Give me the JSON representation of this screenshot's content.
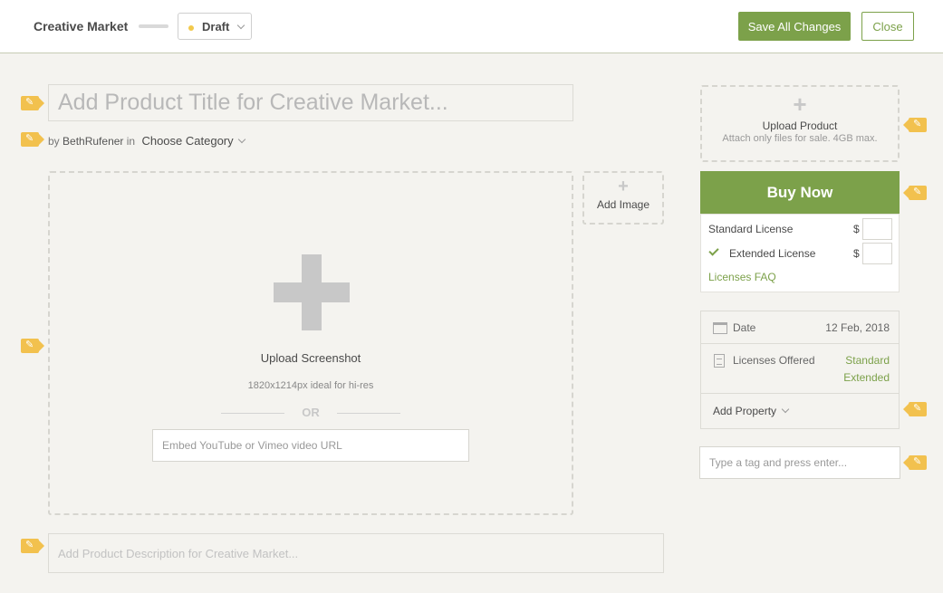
{
  "header": {
    "brand": "Creative Market",
    "status_label": "Draft",
    "save_label": "Save All Changes",
    "close_label": "Close"
  },
  "product": {
    "title_placeholder": "Add Product Title for Creative Market...",
    "by_prefix": "by",
    "author": "BethRufener",
    "in_word": "in",
    "category_label": "Choose Category",
    "description_placeholder": "Add Product Description for Creative Market..."
  },
  "media": {
    "upload_title": "Upload Screenshot",
    "upload_hint": "1820x1214px ideal for hi-res",
    "or_text": "OR",
    "embed_placeholder": "Embed YouTube or Vimeo video URL",
    "add_image_plus": "+",
    "add_image_label": "Add Image"
  },
  "sidebar": {
    "upload_plus": "+",
    "upload_label": "Upload Product",
    "upload_hint": "Attach only files for sale. 4GB max.",
    "buy_now_label": "Buy Now",
    "licenses": [
      {
        "label": "Standard License",
        "currency": "$"
      },
      {
        "label": "Extended License",
        "currency": "$"
      }
    ],
    "licenses_faq": "Licenses FAQ",
    "properties": {
      "date_label": "Date",
      "date_value": "12 Feb, 2018",
      "licenses_label": "Licenses Offered",
      "licenses_values": [
        "Standard",
        "Extended"
      ],
      "add_property_label": "Add Property"
    },
    "tag_placeholder": "Type a tag and press enter..."
  },
  "colors": {
    "accent_green": "#7ca14a",
    "pencil_yellow": "#f2c14e",
    "page_bg": "#f4f3ef",
    "status_dot": "#f2c94c"
  },
  "icons": [
    "pencil-edit-icon",
    "calendar-icon",
    "document-icon",
    "checkmark-icon",
    "chevron-down-icon",
    "plus-icon"
  ]
}
